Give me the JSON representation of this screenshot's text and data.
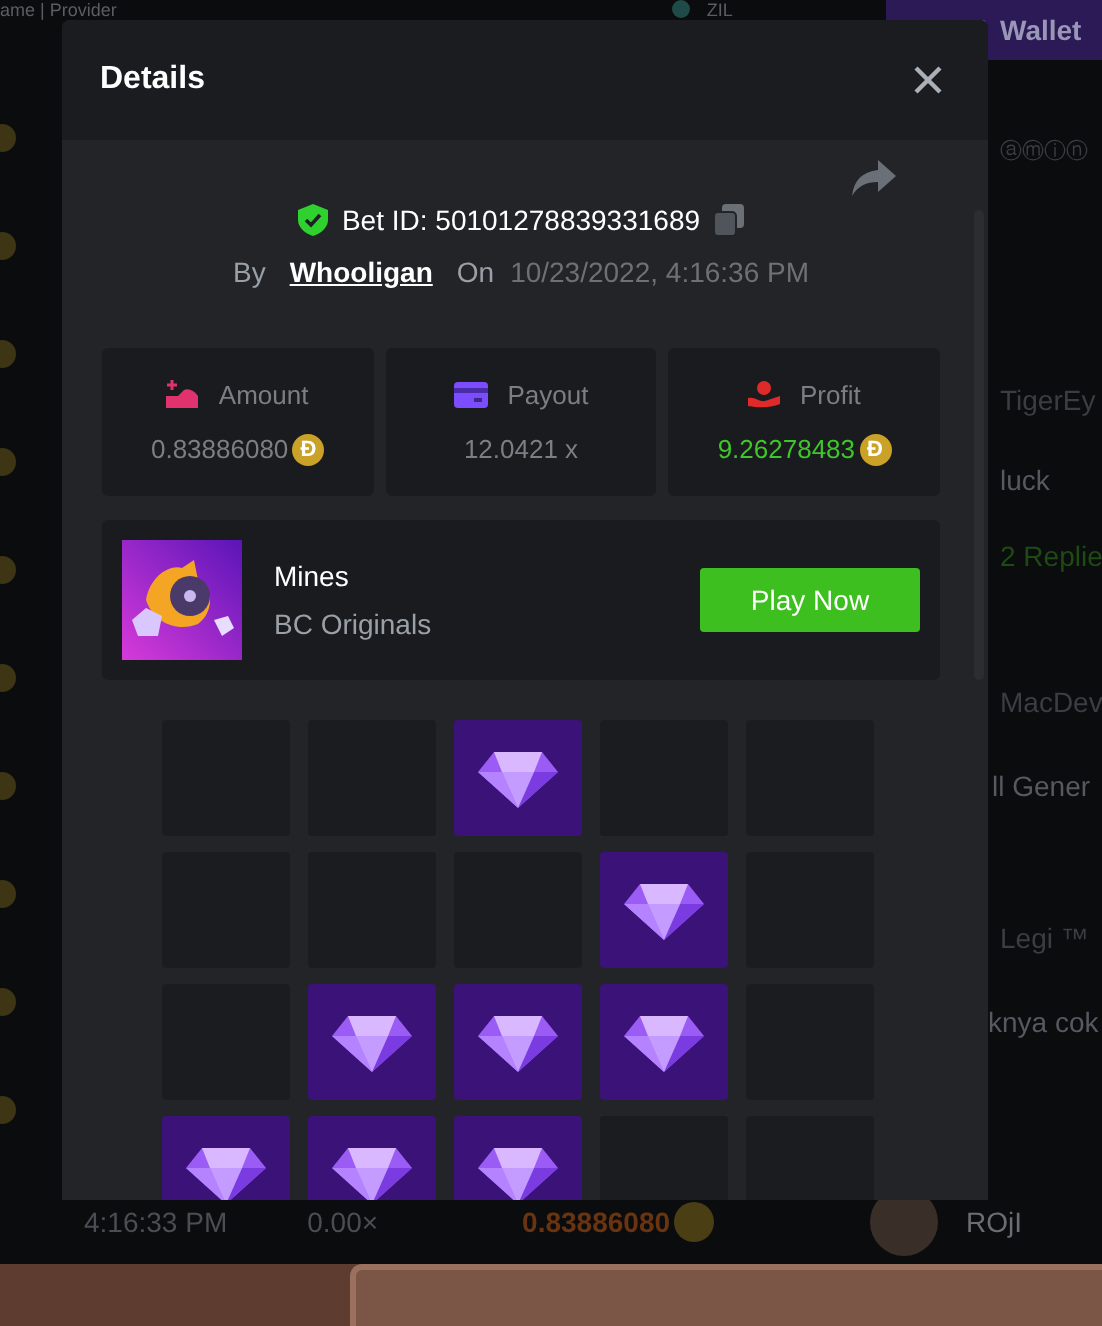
{
  "background_page": {
    "top_bar": {
      "breadcrumb": "ame | Provider",
      "currency": "ZIL",
      "wallet_button": "Wallet"
    },
    "chat": [
      {
        "kind": "name",
        "text": "ⓐⓜⓘⓝ"
      },
      {
        "kind": "name",
        "text": "TigerEy"
      },
      {
        "kind": "message",
        "text": "luck"
      },
      {
        "kind": "replies",
        "text": "2 Replie"
      },
      {
        "kind": "name",
        "text": "MacDev"
      },
      {
        "kind": "message",
        "text": "ll Gener"
      },
      {
        "kind": "name",
        "text": "Legi ™"
      },
      {
        "kind": "message",
        "text": "knya cok"
      }
    ],
    "bet_row": {
      "time": "4:16:33 PM",
      "payout": "0.00×",
      "amount": "0.83886080",
      "user": "ROjI"
    }
  },
  "dialog": {
    "title": "Details",
    "bet_id": "Bet ID: 50101278839331689",
    "by_label": "By",
    "user": "Whooligan",
    "on_label": "On",
    "date": "10/23/2022, 4:16:36 PM",
    "stats": [
      {
        "kind": "amount",
        "label": "Amount",
        "value": "0.83886080",
        "coin": "Ð"
      },
      {
        "kind": "payout",
        "label": "Payout",
        "value": "12.0421 x"
      },
      {
        "kind": "profit",
        "label": "Profit",
        "value": "9.26278483",
        "coin": "Ð"
      }
    ],
    "game": {
      "name": "Mines",
      "provider": "BC Originals",
      "button": "Play Now"
    },
    "grid": [
      [
        false,
        false,
        true,
        false,
        false
      ],
      [
        false,
        false,
        false,
        true,
        false
      ],
      [
        false,
        true,
        true,
        true,
        false
      ],
      [
        true,
        true,
        true,
        false,
        false
      ]
    ]
  }
}
